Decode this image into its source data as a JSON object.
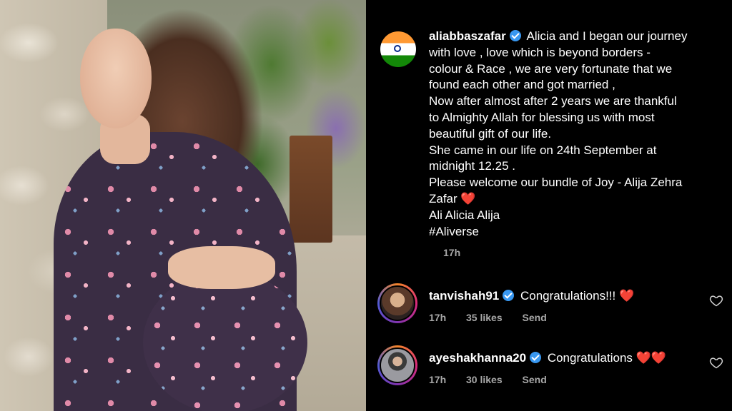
{
  "post": {
    "username": "aliabbaszafar",
    "caption_lines": [
      "Alicia and I began our journey",
      "with love , love which is beyond borders -",
      "colour & Race , we are very fortunate that we",
      "found each other and got married ,",
      "Now after almost after 2 years we are thankful",
      "to Almighty Allah for blessing us with most",
      "beautiful gift of our life.",
      "She came in our life on 24th September at",
      "midnight 12.25 .",
      "Please welcome our bundle of Joy - Alija Zehra",
      "Zafar",
      "Ali Alicia Alija",
      "#Aliverse"
    ],
    "heart": "❤️",
    "time": "17h",
    "avatar_icon": "india-flag-icon"
  },
  "comments": [
    {
      "username": "tanvishah91",
      "text": "Congratulations!!!",
      "hearts": "❤️",
      "time": "17h",
      "likes": "35 likes",
      "send": "Send"
    },
    {
      "username": "ayeshakhanna20",
      "text": "Congratulations",
      "hearts": "❤️❤️",
      "time": "17h",
      "likes": "30 likes",
      "send": "Send"
    }
  ],
  "colors": {
    "background": "#000000",
    "verified_badge": "#3897f0",
    "heart": "#ed2e47",
    "meta_text": "#a8a8a8"
  }
}
